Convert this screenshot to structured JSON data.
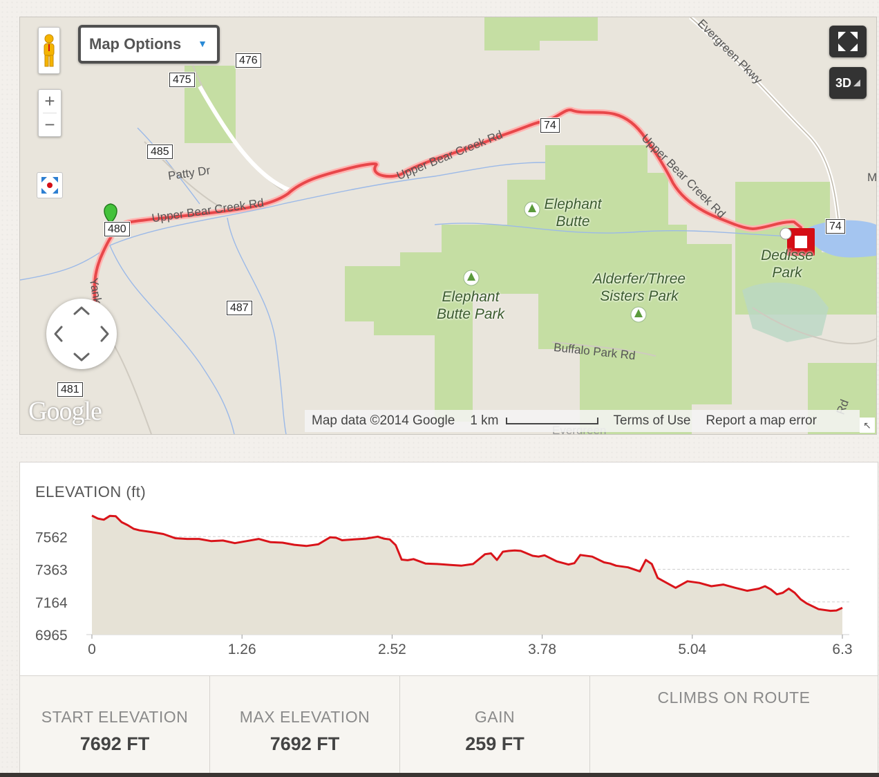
{
  "map": {
    "options_label": "Map Options",
    "zoom_in": "+",
    "zoom_out": "−",
    "btn_3d": "3D",
    "road_shields": [
      "476",
      "475",
      "485",
      "480",
      "487",
      "481",
      "74",
      "74"
    ],
    "labels": {
      "patty_dr": "Patty Dr",
      "upper_bear_creek_1": "Upper Bear Creek Rd",
      "upper_bear_creek_2": "Upper Bear Creek Rd",
      "upper_bear_creek_3": "Upper Bear Creek Rd",
      "evergreen_pkwy": "Evergreen Pkwy",
      "buffalo_park_rd": "Buffalo Park Rd",
      "yank": "Yank",
      "evergreen_bottom": "Evergreen",
      "m_edge": "M",
      "rd_edge": "Rd"
    },
    "parks": {
      "elephant_butte": "Elephant Butte",
      "elephant_butte_park": "Elephant Butte Park",
      "alderfer": "Alderfer/Three Sisters Park",
      "dedisse": "Dedisse Park"
    },
    "google_logo": "Google",
    "footer": {
      "map_data": "Map data ©2014 Google",
      "scale": "1 km",
      "terms": "Terms of Use",
      "report": "Report a map error"
    },
    "route_color": "#e8474a"
  },
  "chart_data": {
    "type": "area",
    "title": "ELEVATION (ft)",
    "xlabel": "",
    "ylabel": "",
    "x_ticks": [
      "0",
      "1.26",
      "2.52",
      "3.78",
      "5.04",
      "6.3"
    ],
    "y_ticks": [
      "7562",
      "7363",
      "7164",
      "6965"
    ],
    "ylim": [
      6965,
      7800
    ],
    "xlim": [
      0,
      6.3
    ],
    "grid": true,
    "line_color": "#d9141a",
    "fill_color": "#e6e2d6",
    "series": [
      {
        "x": [
          0,
          0.05,
          0.1,
          0.15,
          0.2,
          0.25,
          0.3,
          0.35,
          0.4,
          0.5,
          0.6,
          0.7,
          0.8,
          0.9,
          1.0,
          1.1,
          1.2,
          1.3,
          1.4,
          1.5,
          1.6,
          1.7,
          1.8,
          1.9,
          2.0,
          2.05,
          2.1,
          2.2,
          2.3,
          2.4,
          2.45,
          2.5,
          2.55,
          2.6,
          2.65,
          2.7,
          2.8,
          2.9,
          3.0,
          3.1,
          3.2,
          3.3,
          3.35,
          3.4,
          3.45,
          3.5,
          3.55,
          3.6,
          3.7,
          3.75,
          3.8,
          3.9,
          4.0,
          4.05,
          4.1,
          4.2,
          4.3,
          4.35,
          4.4,
          4.5,
          4.6,
          4.65,
          4.7,
          4.75,
          4.8,
          4.9,
          5.0,
          5.1,
          5.2,
          5.3,
          5.4,
          5.5,
          5.6,
          5.65,
          5.7,
          5.75,
          5.8,
          5.85,
          5.9,
          5.95,
          6.0,
          6.1,
          6.2,
          6.25,
          6.3
        ],
        "y": [
          7690,
          7672,
          7665,
          7688,
          7686,
          7650,
          7632,
          7610,
          7600,
          7590,
          7578,
          7552,
          7548,
          7548,
          7535,
          7538,
          7522,
          7535,
          7548,
          7528,
          7525,
          7512,
          7505,
          7515,
          7558,
          7555,
          7540,
          7545,
          7550,
          7562,
          7550,
          7545,
          7510,
          7422,
          7418,
          7425,
          7398,
          7395,
          7390,
          7385,
          7395,
          7455,
          7460,
          7420,
          7470,
          7475,
          7478,
          7475,
          7445,
          7440,
          7448,
          7412,
          7392,
          7400,
          7450,
          7440,
          7405,
          7398,
          7385,
          7375,
          7350,
          7420,
          7395,
          7310,
          7290,
          7250,
          7290,
          7280,
          7260,
          7270,
          7250,
          7232,
          7245,
          7260,
          7240,
          7210,
          7220,
          7245,
          7220,
          7180,
          7155,
          7120,
          7110,
          7112,
          7128
        ]
      }
    ]
  },
  "stats": {
    "start_label": "START ELEVATION",
    "start_value": "7692 FT",
    "max_label": "MAX ELEVATION",
    "max_value": "7692 FT",
    "gain_label": "GAIN",
    "gain_value": "259 FT",
    "climbs_label": "CLIMBS ON ROUTE"
  }
}
